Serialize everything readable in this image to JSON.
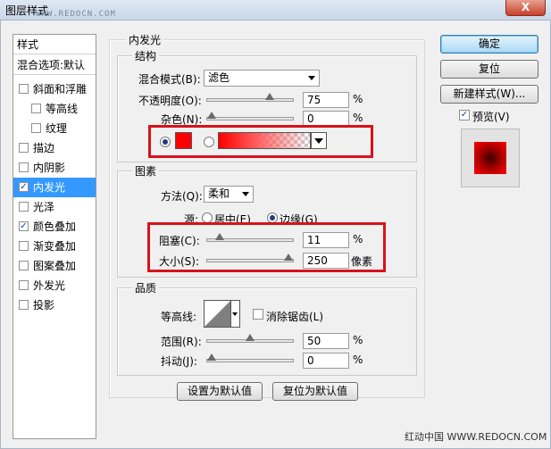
{
  "window": {
    "title": "图层样式",
    "watermark_top": "WWW.REDOCN.COM",
    "close_label": "X"
  },
  "left_panel": {
    "header": "样式",
    "blend_options": "混合选项:默认",
    "items": [
      {
        "label": "斜面和浮雕",
        "checked": false,
        "indent": false,
        "selected": false
      },
      {
        "label": "等高线",
        "checked": false,
        "indent": true,
        "selected": false
      },
      {
        "label": "纹理",
        "checked": false,
        "indent": true,
        "selected": false
      },
      {
        "label": "描边",
        "checked": false,
        "indent": false,
        "selected": false
      },
      {
        "label": "内阴影",
        "checked": false,
        "indent": false,
        "selected": false
      },
      {
        "label": "内发光",
        "checked": true,
        "indent": false,
        "selected": true
      },
      {
        "label": "光泽",
        "checked": false,
        "indent": false,
        "selected": false
      },
      {
        "label": "颜色叠加",
        "checked": true,
        "indent": false,
        "selected": false
      },
      {
        "label": "渐变叠加",
        "checked": false,
        "indent": false,
        "selected": false
      },
      {
        "label": "图案叠加",
        "checked": false,
        "indent": false,
        "selected": false
      },
      {
        "label": "外发光",
        "checked": false,
        "indent": false,
        "selected": false
      },
      {
        "label": "投影",
        "checked": false,
        "indent": false,
        "selected": false
      }
    ]
  },
  "inner_glow": {
    "section_title": "内发光",
    "structure": {
      "title": "结构",
      "blend_mode_label": "混合模式(B):",
      "blend_mode_value": "滤色",
      "opacity_label": "不透明度(O):",
      "opacity_value": "75",
      "opacity_fraction": 0.75,
      "noise_label": "杂色(N):",
      "noise_value": "0",
      "noise_fraction": 0.0,
      "percent": "%",
      "glow_color": "#ff0000"
    },
    "elements": {
      "title": "图素",
      "method_label": "方法(Q):",
      "method_value": "柔和",
      "source_label": "源:",
      "source_center": "居中(E)",
      "source_edge": "边缘(G)",
      "choke_label": "阻塞(C):",
      "choke_value": "11",
      "choke_fraction": 0.11,
      "size_label": "大小(S):",
      "size_value": "250",
      "size_fraction": 1.0,
      "px_unit": "像素",
      "percent": "%"
    },
    "quality": {
      "title": "品质",
      "contour_label": "等高线:",
      "antialias_label": "消除锯齿(L)",
      "range_label": "范围(R):",
      "range_value": "50",
      "range_fraction": 0.5,
      "jitter_label": "抖动(J):",
      "jitter_value": "0",
      "jitter_fraction": 0.0,
      "percent": "%"
    },
    "set_default": "设置为默认值",
    "reset_default": "复位为默认值"
  },
  "right_panel": {
    "ok": "确定",
    "reset": "复位",
    "new_style": "新建样式(W)...",
    "preview_label": "预览(V)",
    "preview_checked": true
  },
  "footer_watermark": "红动中国 WWW.REDOCN.COM"
}
